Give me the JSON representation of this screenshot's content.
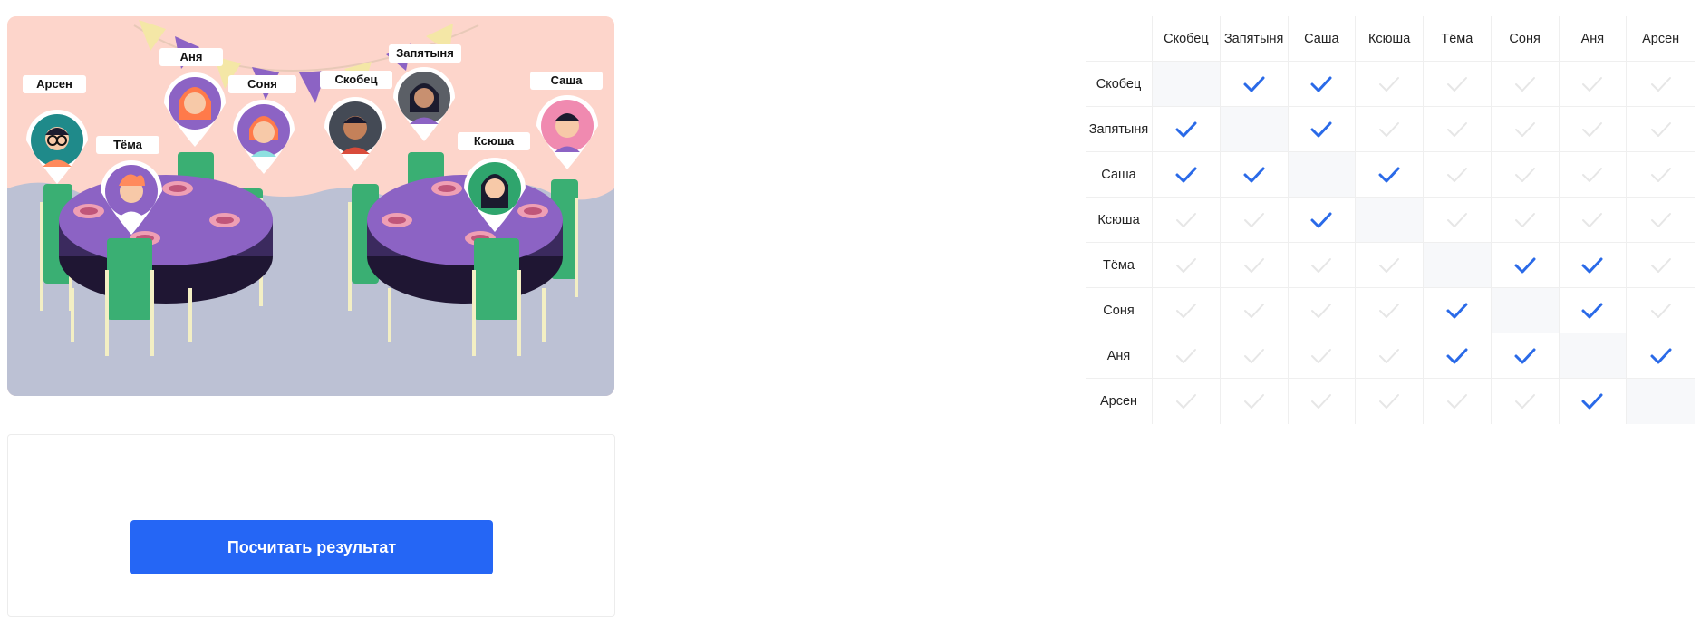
{
  "people": [
    "Скобец",
    "Запятыня",
    "Саша",
    "Ксюша",
    "Тёма",
    "Соня",
    "Аня",
    "Арсен"
  ],
  "illustration": {
    "tags": [
      "Арсен",
      "Тёма",
      "Аня",
      "Соня",
      "Скобец",
      "Запятыня",
      "Ксюша",
      "Саша"
    ]
  },
  "button": {
    "label": "Посчитать результат"
  },
  "matrix": [
    [
      false,
      true,
      true,
      false,
      false,
      false,
      false,
      false
    ],
    [
      true,
      false,
      true,
      false,
      false,
      false,
      false,
      false
    ],
    [
      true,
      true,
      false,
      true,
      false,
      false,
      false,
      false
    ],
    [
      false,
      false,
      true,
      false,
      false,
      false,
      false,
      false
    ],
    [
      false,
      false,
      false,
      false,
      false,
      true,
      true,
      false
    ],
    [
      false,
      false,
      false,
      false,
      true,
      false,
      true,
      false
    ],
    [
      false,
      false,
      false,
      false,
      true,
      true,
      false,
      true
    ],
    [
      false,
      false,
      false,
      false,
      false,
      false,
      true,
      false
    ]
  ],
  "colors": {
    "accent": "#2566f5",
    "check_on": "#2a6ae8",
    "check_off": "#e6e6e6",
    "scene_wall": "#fdd5cb",
    "scene_floor": "#bcc1d4",
    "table_top": "#8c63c4",
    "chair": "#3aaf73"
  }
}
